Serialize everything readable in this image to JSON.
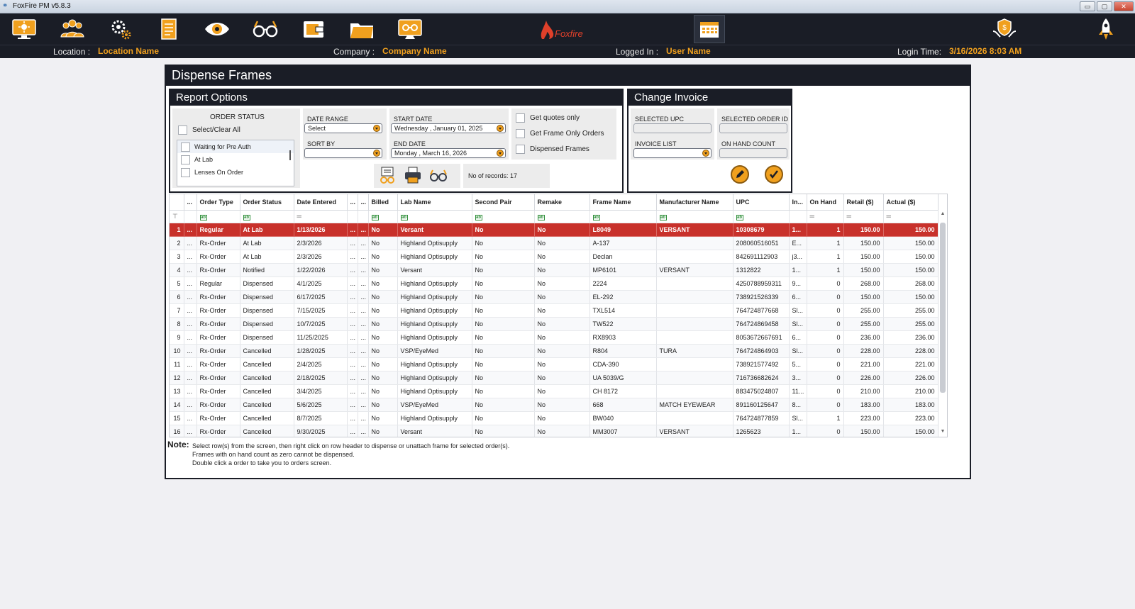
{
  "window": {
    "title": "FoxFire PM v5.8.3",
    "buttons": {
      "minimize": "▭",
      "restore": "▢",
      "close": "✕"
    }
  },
  "toolbar": {
    "icons": [
      "dashboard-icon",
      "patients-icon",
      "settings-icon",
      "reports-icon",
      "eye-exam-icon",
      "glasses-icon",
      "wallet-icon",
      "folder-icon",
      "frames-icon",
      "calendar-icon",
      "insurance-icon",
      "rocket-icon"
    ],
    "brand": "Foxfire",
    "accent": "#f0a01e",
    "background": "#1a1d26"
  },
  "info": {
    "location_label": "Location :",
    "location_value": "Location Name",
    "company_label": "Company :",
    "company_value": "Company Name",
    "logged_label": "Logged In :",
    "logged_value": "User Name",
    "login_time_label": "Login Time:",
    "login_time_value": "3/16/2026 8:03 AM"
  },
  "page": {
    "title": "Dispense Frames"
  },
  "report_options": {
    "title": "Report Options",
    "order_status_title": "ORDER STATUS",
    "select_clear_all": "Select/Clear All",
    "statuses": [
      "Waiting for Pre Auth",
      "At Lab",
      "Lenses On Order"
    ],
    "date_range_label": "DATE RANGE",
    "date_range_value": "Select",
    "sort_by_label": "SORT BY",
    "sort_by_value": "",
    "start_date_label": "START DATE",
    "start_date_value": "Wednesday ,  January  01,  2025",
    "end_date_label": "END DATE",
    "end_date_value": "Monday ,  March  16,  2026",
    "get_quotes_only": "Get quotes only",
    "get_frame_only_orders": "Get Frame Only Orders",
    "dispensed_frames": "Dispensed Frames",
    "records_label": "No of records: 17"
  },
  "change_invoice": {
    "title": "Change Invoice",
    "selected_upc_label": "SELECTED UPC",
    "selected_order_id_label": "SELECTED ORDER ID",
    "invoice_list_label": "INVOICE LIST",
    "on_hand_count_label": "ON HAND COUNT"
  },
  "grid": {
    "columns": [
      "",
      "...",
      "Order Type",
      "Order Status",
      "Date Entered",
      "...",
      "...",
      "Billed",
      "Lab Name",
      "Second Pair",
      "Remake",
      "Frame Name",
      "Manufacturer Name",
      "UPC",
      "In...",
      "On Hand",
      "Retail ($)",
      "Actual ($)"
    ],
    "rows": [
      [
        "1",
        "...",
        "Regular",
        "At Lab",
        "1/13/2026",
        "...",
        "...",
        "No",
        "Versant",
        "No",
        "No",
        "L8049",
        "VERSANT",
        "10308679",
        "1...",
        "1",
        "150.00",
        "150.00"
      ],
      [
        "2",
        "...",
        "Rx-Order",
        "At Lab",
        "2/3/2026",
        "...",
        "...",
        "No",
        "Highland Optisupply",
        "No",
        "No",
        "A-137",
        "",
        "208060516051",
        "E...",
        "1",
        "150.00",
        "150.00"
      ],
      [
        "3",
        "...",
        "Rx-Order",
        "At Lab",
        "2/3/2026",
        "...",
        "...",
        "No",
        "Highland Optisupply",
        "No",
        "No",
        "Declan",
        "",
        "842691112903",
        "j3...",
        "1",
        "150.00",
        "150.00"
      ],
      [
        "4",
        "...",
        "Rx-Order",
        "Notified",
        "1/22/2026",
        "...",
        "...",
        "No",
        "Versant",
        "No",
        "No",
        "MP6101",
        "VERSANT",
        "1312822",
        "1...",
        "1",
        "150.00",
        "150.00"
      ],
      [
        "5",
        "...",
        "Regular",
        "Dispensed",
        "4/1/2025",
        "...",
        "...",
        "No",
        "Highland Optisupply",
        "No",
        "No",
        "2224",
        "",
        "4250788959311",
        "9...",
        "0",
        "268.00",
        "268.00"
      ],
      [
        "6",
        "...",
        "Rx-Order",
        "Dispensed",
        "6/17/2025",
        "...",
        "...",
        "No",
        "Highland Optisupply",
        "No",
        "No",
        "EL-292",
        "",
        "738921526339",
        "6...",
        "0",
        "150.00",
        "150.00"
      ],
      [
        "7",
        "...",
        "Rx-Order",
        "Dispensed",
        "7/15/2025",
        "...",
        "...",
        "No",
        "Highland Optisupply",
        "No",
        "No",
        "TXL514",
        "",
        "764724877668",
        "Sl...",
        "0",
        "255.00",
        "255.00"
      ],
      [
        "8",
        "...",
        "Rx-Order",
        "Dispensed",
        "10/7/2025",
        "...",
        "...",
        "No",
        "Highland Optisupply",
        "No",
        "No",
        "TW522",
        "",
        "764724869458",
        "Sl...",
        "0",
        "255.00",
        "255.00"
      ],
      [
        "9",
        "...",
        "Rx-Order",
        "Dispensed",
        "11/25/2025",
        "...",
        "...",
        "No",
        "Highland Optisupply",
        "No",
        "No",
        "RX8903",
        "",
        "8053672667691",
        "6...",
        "0",
        "236.00",
        "236.00"
      ],
      [
        "10",
        "...",
        "Rx-Order",
        "Cancelled",
        "1/28/2025",
        "...",
        "...",
        "No",
        "VSP/EyeMed",
        "No",
        "No",
        "R804",
        "TURA",
        "764724864903",
        "Sl...",
        "0",
        "228.00",
        "228.00"
      ],
      [
        "11",
        "...",
        "Rx-Order",
        "Cancelled",
        "2/4/2025",
        "...",
        "...",
        "No",
        "Highland Optisupply",
        "No",
        "No",
        "CDA-390",
        "",
        "738921577492",
        "5...",
        "0",
        "221.00",
        "221.00"
      ],
      [
        "12",
        "...",
        "Rx-Order",
        "Cancelled",
        "2/18/2025",
        "...",
        "...",
        "No",
        "Highland Optisupply",
        "No",
        "No",
        "UA 5039/G",
        "",
        "716736682624",
        "3...",
        "0",
        "226.00",
        "226.00"
      ],
      [
        "13",
        "...",
        "Rx-Order",
        "Cancelled",
        "3/4/2025",
        "...",
        "...",
        "No",
        "Highland Optisupply",
        "No",
        "No",
        "CH 8172",
        "",
        "883475024807",
        "11...",
        "0",
        "210.00",
        "210.00"
      ],
      [
        "14",
        "...",
        "Rx-Order",
        "Cancelled",
        "5/6/2025",
        "...",
        "...",
        "No",
        "VSP/EyeMed",
        "No",
        "No",
        "668",
        "MATCH EYEWEAR",
        "891160125647",
        "8...",
        "0",
        "183.00",
        "183.00"
      ],
      [
        "15",
        "...",
        "Rx-Order",
        "Cancelled",
        "8/7/2025",
        "...",
        "...",
        "No",
        "Highland Optisupply",
        "No",
        "No",
        "BW040",
        "",
        "764724877859",
        "Sl...",
        "1",
        "223.00",
        "223.00"
      ],
      [
        "16",
        "...",
        "Rx-Order",
        "Cancelled",
        "9/30/2025",
        "...",
        "...",
        "No",
        "Versant",
        "No",
        "No",
        "MM3007",
        "VERSANT",
        "1265623",
        "1...",
        "0",
        "150.00",
        "150.00"
      ]
    ],
    "highlight_color": "#c8312b"
  },
  "note": {
    "label": "Note:",
    "line1": "Select row(s) from the screen, then right click on row header to dispense or unattach frame for selected order(s).",
    "line2": "Frames with on hand count as zero cannot be dispensed.",
    "line3": "Double click a order to take you to orders screen."
  }
}
